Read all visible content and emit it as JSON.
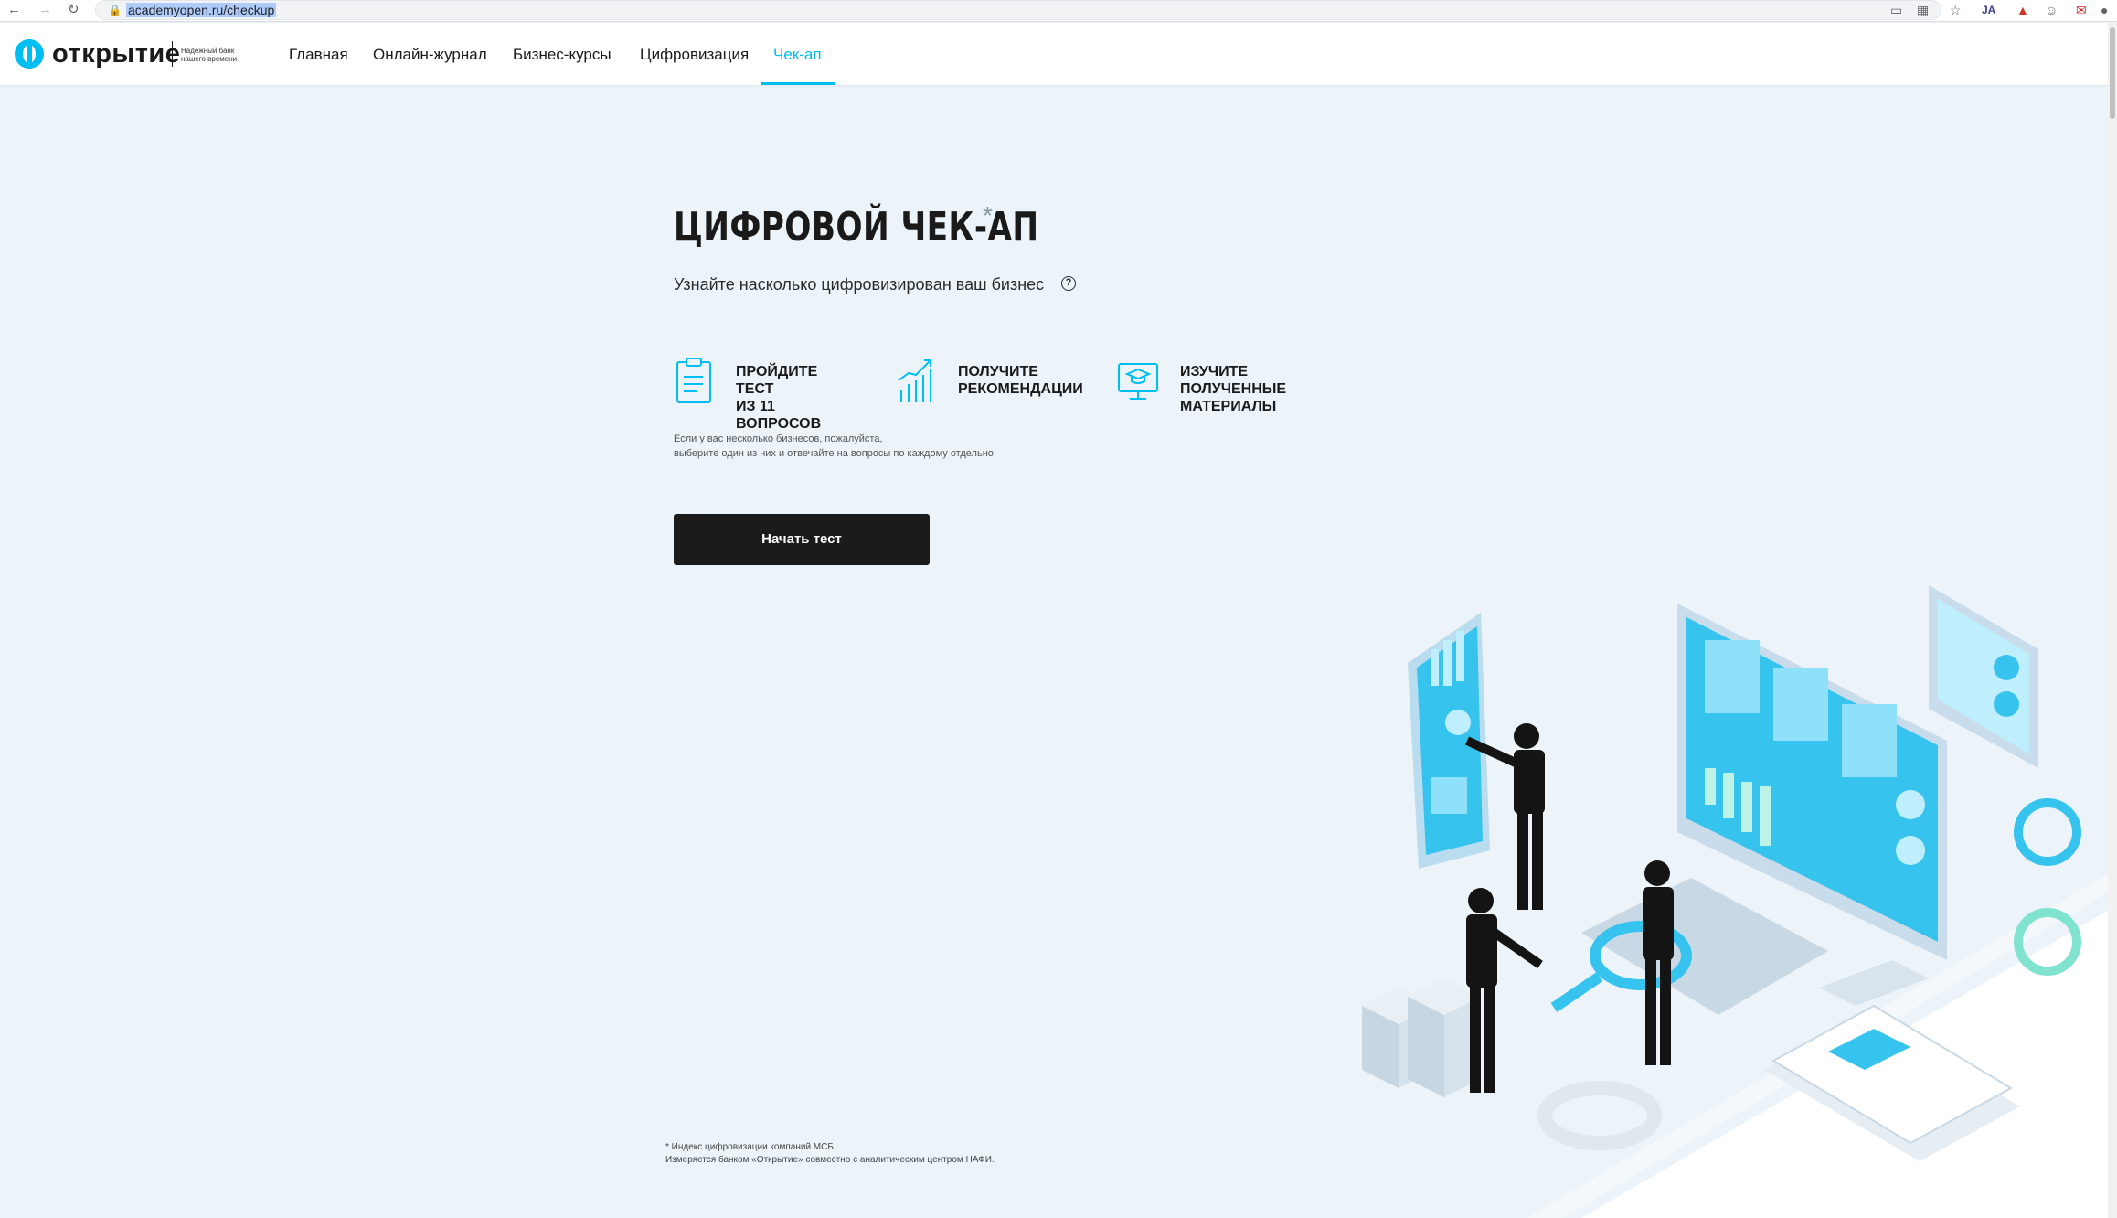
{
  "browser": {
    "url": "academyopen.ru/checkup",
    "ext_ja": "JA"
  },
  "header": {
    "logo_word": "открытие",
    "logo_tagline": "Надёжный банк нашего времени",
    "nav": [
      {
        "label": "Главная"
      },
      {
        "label": "Онлайн-журнал"
      },
      {
        "label": "Бизнес-курсы"
      },
      {
        "label": "Цифровизация"
      },
      {
        "label": "Чек-ап",
        "active": true
      }
    ]
  },
  "hero": {
    "title": "ЦИФРОВОЙ ЧЕК-АП",
    "asterisk": "*",
    "subtitle": "Узнайте насколько цифровизирован ваш бизнес",
    "help_icon": "?"
  },
  "steps": [
    {
      "icon": "clipboard-icon",
      "label": "ПРОЙДИТЕ ТЕСТ\nИЗ 11 ВОПРОСОВ"
    },
    {
      "icon": "growth-chart-icon",
      "label": "ПОЛУЧИТЕ\nРЕКОМЕНДАЦИИ"
    },
    {
      "icon": "monitor-graduation-icon",
      "label": "ИЗУЧИТЕ ПОЛУЧЕННЫЕ\nМАТЕРИАЛЫ"
    }
  ],
  "note": "Если у вас несколько бизнесов, пожалуйста,\nвыберите один из них и отвечайте на вопросы по каждому отдельно",
  "start_button": "Начать тест",
  "footnote": "*  Индекс цифровизации компаний МСБ.\n    Измеряется банком «Открытие» совместно с аналитическим центром НАФИ.",
  "colors": {
    "accent": "#00bef0",
    "background": "#ecf4f9",
    "button": "#1b1b1b"
  }
}
